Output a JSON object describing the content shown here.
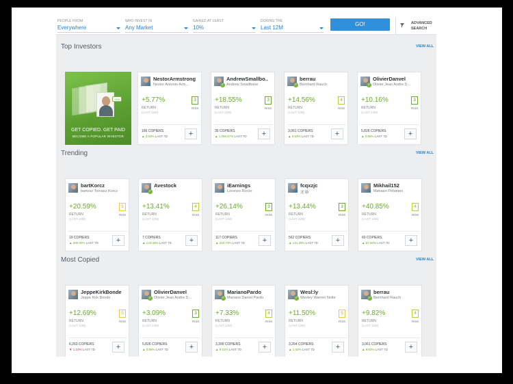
{
  "filters": [
    {
      "label": "PEOPLE FROM",
      "value": "Everywhere"
    },
    {
      "label": "WHO INVEST IN",
      "value": "Any Market"
    },
    {
      "label": "GAINED AT LEAST",
      "value": "10%"
    },
    {
      "label": "DURING THE",
      "value": "Last 12M"
    }
  ],
  "go_label": "GO!",
  "advanced_search": "ADVANCED SEARCH",
  "promo": {
    "title": "GET COPIED. GET PAID",
    "subtitle": "BECOME A POPULAR INVESTOR",
    "badge": "+1%"
  },
  "labels": {
    "return": "RETURN",
    "risk": "RISK",
    "period": "(LAST 12M)",
    "last_7d": "LAST 7D"
  },
  "sections": [
    {
      "title": "Top Investors",
      "view_all": "VIEW ALL",
      "cards": [
        {
          "username": "NestorArmstrong",
          "full_name": "Nestor Antonio Arm...",
          "return": "+5.77%",
          "risk": "3",
          "copiers": "166 COPIERS",
          "growth": "▲ 3.53%",
          "neg": false,
          "badge": "star"
        },
        {
          "username": "AndrewSmallbo..",
          "full_name": "Andrew Smallbone",
          "return": "+18.55%",
          "risk": "3",
          "copiers": "35 COPIERS",
          "growth": "▲ 1,066.67%",
          "neg": false,
          "badge": "check"
        },
        {
          "username": "berrau",
          "full_name": "Bernhard Rauch",
          "return": "+14.56%",
          "risk": "4",
          "copiers": "3,061 COPIERS",
          "growth": "▲ 9.63%",
          "neg": false,
          "badge": "check"
        },
        {
          "username": "OlivierDanvel",
          "full_name": "Olivier Jean Andre D...",
          "return": "+10.16%",
          "risk": "3",
          "copiers": "5,826 COPIERS",
          "growth": "▲ 0.88%",
          "neg": false,
          "badge": "check"
        }
      ]
    },
    {
      "title": "Trending",
      "view_all": "VIEW ALL",
      "cards": [
        {
          "username": "bartKorcz",
          "full_name": "bartosz Tomasz Korcz",
          "return": "+20.59%",
          "risk": "5",
          "copiers": "19 COPIERS",
          "growth": "▲ 280.00%",
          "neg": false,
          "badge": "none"
        },
        {
          "username": "Avestock",
          "full_name": "",
          "return": "+13.41%",
          "risk": "4",
          "copiers": "7 COPIERS",
          "growth": "▲ 133.33%",
          "neg": false,
          "badge": "check"
        },
        {
          "username": "iEarnings",
          "full_name": "Lorenzo Riccio",
          "return": "+26.14%",
          "risk": "3",
          "copiers": "117 COPIERS",
          "growth": "▲ 332.73%",
          "neg": false,
          "badge": "star"
        },
        {
          "username": "fcqxzjc",
          "full_name": "沈 新",
          "return": "+13.44%",
          "risk": "3",
          "copiers": "562 COPIERS",
          "growth": "▲ 131.28%",
          "neg": false,
          "badge": "star"
        },
        {
          "username": "Mikhail152",
          "full_name": "Михаил Рябинин",
          "return": "+40.85%",
          "risk": "4",
          "copiers": "60 COPIERS",
          "growth": "▲ 87.50%",
          "neg": false,
          "badge": "star"
        }
      ]
    },
    {
      "title": "Most Copied",
      "view_all": "VIEW ALL",
      "cards": [
        {
          "username": "JeppeKirkBonde",
          "full_name": "Jeppe Kirk Bonde",
          "return": "+12.69%",
          "risk": "5",
          "copiers": "6,263 COPIERS",
          "growth": "▼ 1.10%",
          "neg": true,
          "badge": "none"
        },
        {
          "username": "OlivierDanvel",
          "full_name": "Olivier Jean Andre D...",
          "return": "+3.09%",
          "risk": "3",
          "copiers": "5,826 COPIERS",
          "growth": "▲ 0.88%",
          "neg": false,
          "badge": "check"
        },
        {
          "username": "MarianoPardo",
          "full_name": "Mariano Daniel Pardo",
          "return": "+7.33%",
          "risk": "4",
          "copiers": "3,399 COPIERS",
          "growth": "▲ 9.51%",
          "neg": false,
          "badge": "check"
        },
        {
          "username": "Wesl:ly",
          "full_name": "Wesley Warren Nolte",
          "return": "+11.50%",
          "risk": "5",
          "copiers": "3,264 COPIERS",
          "growth": "▲ 1.62%",
          "neg": false,
          "badge": "check"
        },
        {
          "username": "berrau",
          "full_name": "Bernhard Rauch",
          "return": "+9.82%",
          "risk": "4",
          "copiers": "3,061 COPIERS",
          "growth": "▲ 9.63%",
          "neg": false,
          "badge": "check"
        }
      ]
    }
  ]
}
